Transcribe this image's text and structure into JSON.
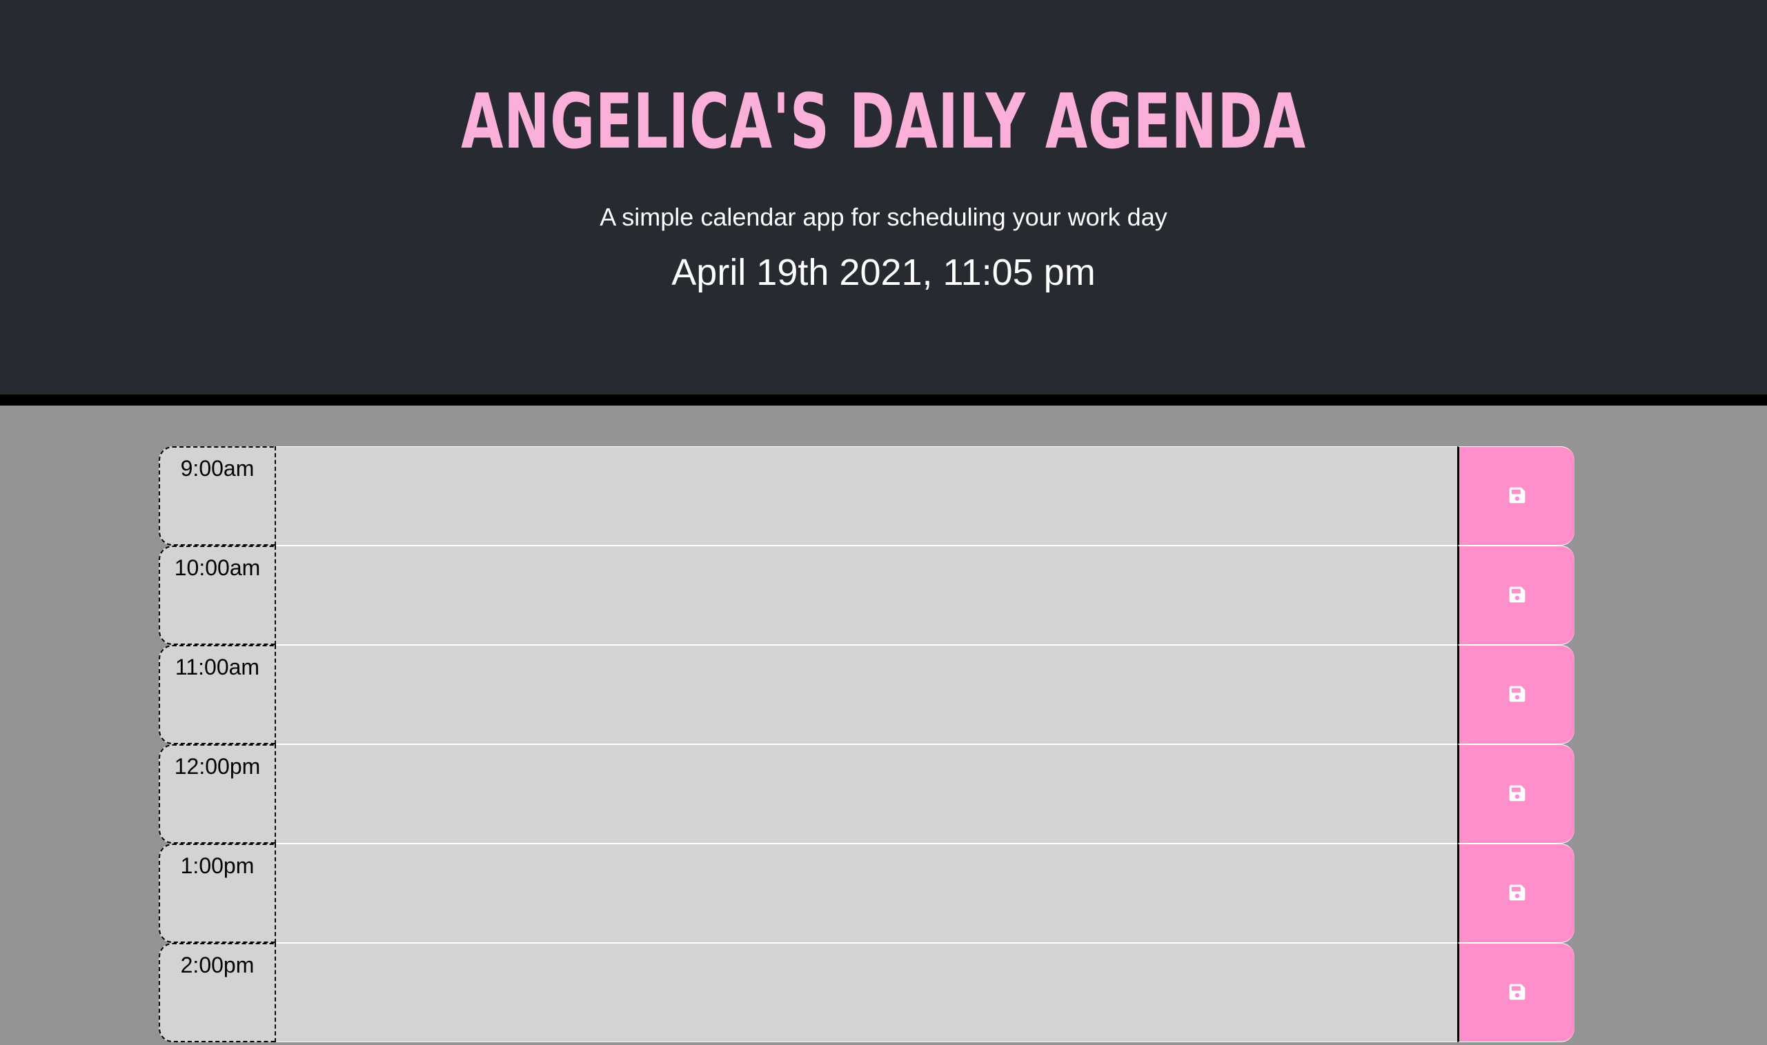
{
  "header": {
    "title": "Angelica's Daily Agenda",
    "lead": "A simple calendar app for scheduling your work day",
    "current_day": "April 19th 2021, 11:05 pm"
  },
  "timeblocks": [
    {
      "hour": "9:00am",
      "description": "",
      "save_icon": "save-icon"
    },
    {
      "hour": "10:00am",
      "description": "",
      "save_icon": "save-icon"
    },
    {
      "hour": "11:00am",
      "description": "",
      "save_icon": "save-icon"
    },
    {
      "hour": "12:00pm",
      "description": "",
      "save_icon": "save-icon"
    },
    {
      "hour": "1:00pm",
      "description": "",
      "save_icon": "save-icon"
    },
    {
      "hour": "2:00pm",
      "description": "",
      "save_icon": "save-icon"
    }
  ],
  "colors": {
    "header_bg": "#272a30",
    "title": "#fbb0d9",
    "save_button": "#ff8fcb",
    "timeblock_bg": "#d3d3d3",
    "page_bg": "#949494"
  }
}
